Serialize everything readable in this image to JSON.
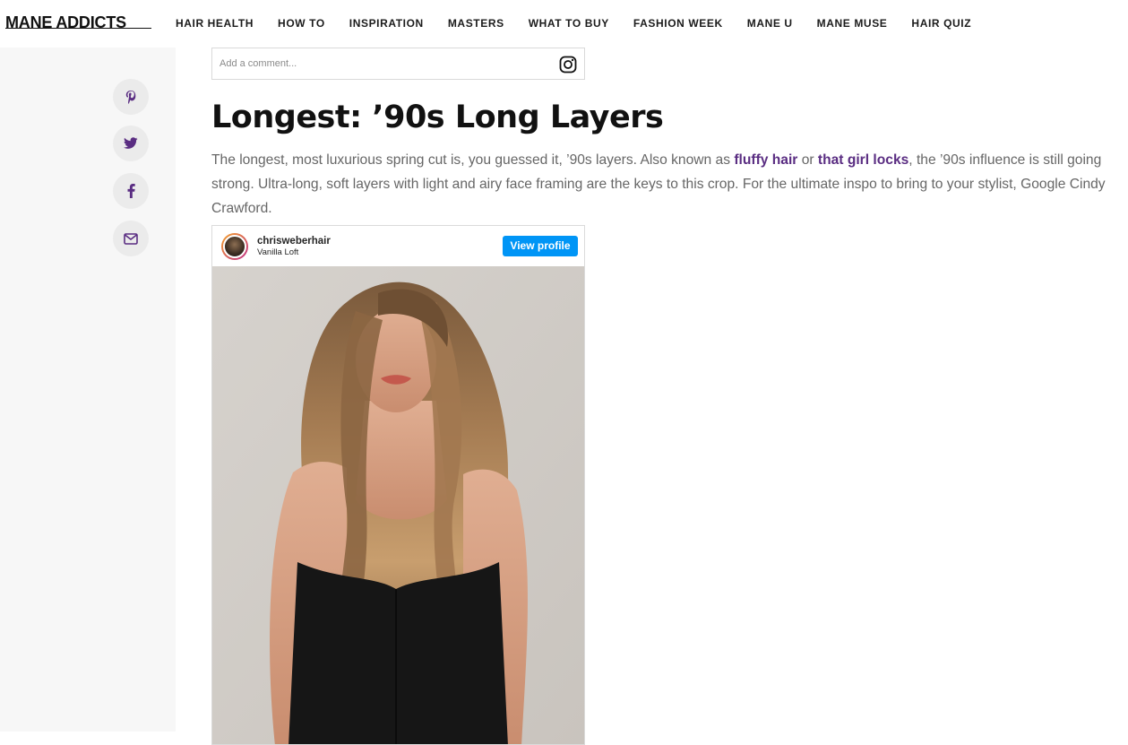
{
  "header": {
    "logo": "MANE ADDICTS",
    "nav": [
      "HAIR HEALTH",
      "HOW TO",
      "INSPIRATION",
      "MASTERS",
      "WHAT TO BUY",
      "FASHION WEEK",
      "MANE U",
      "MANE MUSE",
      "HAIR QUIZ"
    ]
  },
  "share": {
    "icons": [
      "pinterest-icon",
      "twitter-icon",
      "facebook-icon",
      "email-icon"
    ],
    "accent_color": "#5a2d82"
  },
  "comment": {
    "placeholder": "Add a comment..."
  },
  "article": {
    "headline": "Longest: ’90s Long Layers",
    "body_part1": "The longest, most luxurious spring cut is, you guessed it, ’90s layers. Also known as ",
    "link1": "fluffy hair",
    "body_part2": " or ",
    "link2": "that girl locks",
    "body_part3": ", the ’90s influence is still going strong. Ultra-long, soft layers with light and airy face framing are the keys to this crop. For the ultimate inspo to bring to your stylist, Google Cindy Crawford."
  },
  "instagram_embed": {
    "username": "chrisweberhair",
    "location": "Vanilla Loft",
    "button_label": "View profile",
    "button_color": "#0095f6"
  }
}
